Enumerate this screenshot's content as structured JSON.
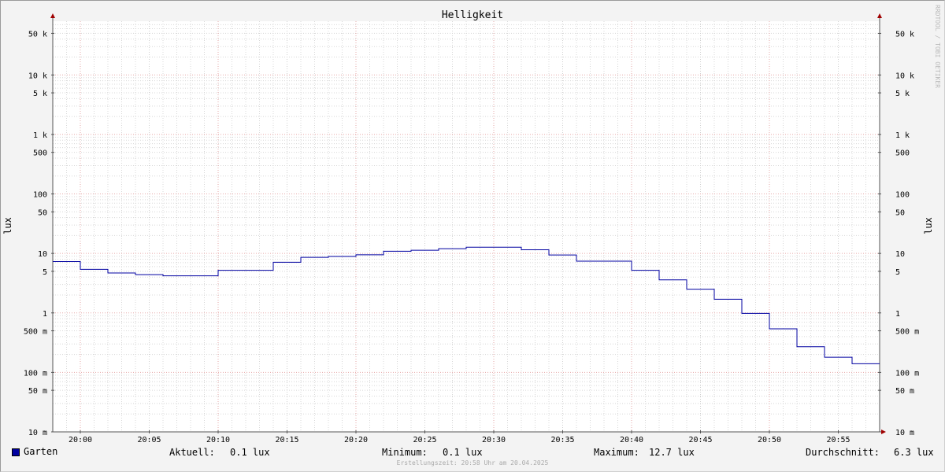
{
  "chart_data": {
    "type": "line",
    "title": "Helligkeit",
    "ylabel_left": "lux",
    "ylabel_right": "lux",
    "yscale": "log",
    "ylim": [
      0.01,
      80000
    ],
    "x_ticks": [
      "20:00",
      "20:05",
      "20:10",
      "20:15",
      "20:20",
      "20:25",
      "20:30",
      "20:35",
      "20:40",
      "20:45",
      "20:50",
      "20:55"
    ],
    "x_tick_minutes": [
      0,
      5,
      10,
      15,
      20,
      25,
      30,
      35,
      40,
      45,
      50,
      55
    ],
    "xlim_minutes": [
      -2,
      58
    ],
    "y_ticks": [
      {
        "value": 50000,
        "label": "50 k"
      },
      {
        "value": 10000,
        "label": "10 k"
      },
      {
        "value": 5000,
        "label": "5 k"
      },
      {
        "value": 1000,
        "label": "1 k"
      },
      {
        "value": 500,
        "label": "500"
      },
      {
        "value": 100,
        "label": "100"
      },
      {
        "value": 50,
        "label": "50"
      },
      {
        "value": 10,
        "label": "10"
      },
      {
        "value": 5,
        "label": "5"
      },
      {
        "value": 1,
        "label": "1"
      },
      {
        "value": 0.5,
        "label": "500 m"
      },
      {
        "value": 0.1,
        "label": "100 m"
      },
      {
        "value": 0.05,
        "label": "50 m"
      },
      {
        "value": 0.01,
        "label": "10 m"
      }
    ],
    "grid": true,
    "series": [
      {
        "name": "Garten",
        "color": "#0000a0",
        "step": true,
        "x_minutes": [
          -2,
          0,
          2,
          4,
          6,
          8,
          10,
          12,
          14,
          16,
          18,
          20,
          22,
          24,
          26,
          28,
          30,
          32,
          34,
          36,
          38,
          40,
          42,
          44,
          46,
          48,
          50,
          52,
          54,
          56
        ],
        "values": [
          7.3,
          5.4,
          4.7,
          4.4,
          4.2,
          4.2,
          5.2,
          5.2,
          7.1,
          8.6,
          8.9,
          9.5,
          10.9,
          11.3,
          12.0,
          12.7,
          12.7,
          11.5,
          9.4,
          7.4,
          7.4,
          5.2,
          3.6,
          2.5,
          1.7,
          0.98,
          0.54,
          0.27,
          0.18,
          0.14
        ],
        "x_end_minutes": 58
      }
    ]
  },
  "legend": {
    "name": "Garten",
    "aktuell_label": "Aktuell:",
    "aktuell_value": "0.1 lux",
    "minimum_label": "Minimum:",
    "minimum_value": "0.1 lux",
    "maximum_label": "Maximum:",
    "maximum_value": "12.7 lux",
    "durchschnitt_label": "Durchschnitt:",
    "durchschnitt_value": "6.3 lux"
  },
  "footer": "Erstellungszeit: 20:58 Uhr am 20.04.2025",
  "watermark": "RRDTOOL / TOBI OETIKER"
}
